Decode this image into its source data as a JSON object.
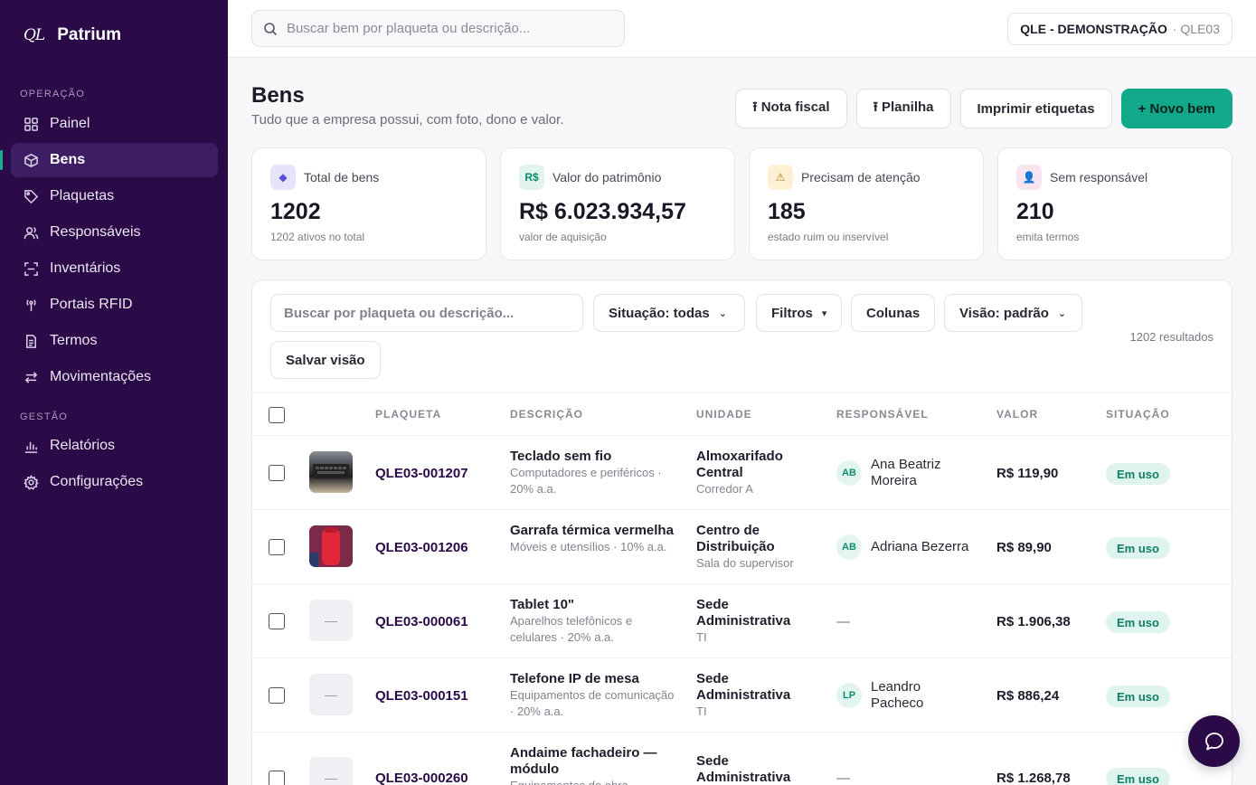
{
  "brand": {
    "logo": "QL",
    "name": "Patrium"
  },
  "sidebar": {
    "section_operacao": "OPERAÇÃO",
    "section_gestao": "GESTÃO",
    "items": [
      {
        "label": "Painel",
        "icon": "grid-icon"
      },
      {
        "label": "Bens",
        "icon": "box-icon"
      },
      {
        "label": "Plaquetas",
        "icon": "tag-icon"
      },
      {
        "label": "Responsáveis",
        "icon": "users-icon"
      },
      {
        "label": "Inventários",
        "icon": "scan-icon"
      },
      {
        "label": "Portais RFID",
        "icon": "antenna-icon"
      },
      {
        "label": "Termos",
        "icon": "document-icon"
      },
      {
        "label": "Movimentações",
        "icon": "arrows-icon"
      },
      {
        "label": "Relatórios",
        "icon": "bar-chart-icon"
      },
      {
        "label": "Configurações",
        "icon": "gear-icon"
      }
    ]
  },
  "topbar": {
    "search_placeholder": "Buscar bem por plaqueta ou descrição...",
    "tenant_name": "QLE - DEMONSTRAÇÃO",
    "tenant_code": "· QLE03"
  },
  "header": {
    "title": "Bens",
    "subtitle": "Tudo que a empresa possui, com foto, dono e valor.",
    "actions": {
      "nota_fiscal": "⭱ Nota fiscal",
      "planilha": "⭱ Planilha",
      "imprimir": "Imprimir etiquetas",
      "novo": "+ Novo bem"
    }
  },
  "stats": [
    {
      "icon_text": "◆",
      "label": "Total de bens",
      "value": "1202",
      "caption": "1202 ativos no total",
      "color": "#e6e4fb"
    },
    {
      "icon_text": "R$",
      "label": "Valor do patrimônio",
      "value": "R$ 6.023.934,57",
      "caption": "valor de aquisição",
      "color": "#e1f4ee"
    },
    {
      "icon_text": "⚠",
      "label": "Precisam de atenção",
      "value": "185",
      "caption": "estado ruim ou inservível",
      "color": "#fdf0d4"
    },
    {
      "icon_text": "👤",
      "label": "Sem responsável",
      "value": "210",
      "caption": "emita termos",
      "color": "#f8e3f0"
    }
  ],
  "filters": {
    "search_placeholder": "Buscar por plaqueta ou descrição...",
    "situacao": "Situação: todas",
    "filtros": "Filtros",
    "colunas": "Colunas",
    "visao": "Visão: padrão",
    "salvar": "Salvar visão",
    "results": "1202 resultados"
  },
  "table": {
    "headers": {
      "plaqueta": "PLAQUETA",
      "descricao": "DESCRIÇÃO",
      "unidade": "UNIDADE",
      "responsavel": "RESPONSÁVEL",
      "valor": "VALOR",
      "situacao": "SITUAÇÃO"
    },
    "rows": [
      {
        "tag": "QLE03-001207",
        "title": "Teclado sem fio",
        "sub": "Computadores e periféricos · 20% a.a.",
        "unit": "Almoxarifado Central",
        "unit_sub": "Corredor A",
        "initials": "AB",
        "resp": "Ana Beatriz Moreira",
        "value": "R$ 119,90",
        "status": "Em uso",
        "thumb": "—"
      },
      {
        "tag": "QLE03-001206",
        "title": "Garrafa térmica vermelha",
        "sub": "Móveis e utensílios · 10% a.a.",
        "unit": "Centro de Distribuição",
        "unit_sub": "Sala do supervisor",
        "initials": "AB",
        "resp": "Adriana Bezerra",
        "value": "R$ 89,90",
        "status": "Em uso",
        "thumb": "—"
      },
      {
        "tag": "QLE03-000061",
        "title": "Tablet 10\"",
        "sub": "Aparelhos telefônicos e celulares · 20% a.a.",
        "unit": "Sede Administrativa",
        "unit_sub": "TI",
        "initials": "",
        "resp": "—",
        "value": "R$ 1.906,38",
        "status": "Em uso",
        "thumb": "—"
      },
      {
        "tag": "QLE03-000151",
        "title": "Telefone IP de mesa",
        "sub": "Equipamentos de comunicação · 20% a.a.",
        "unit": "Sede Administrativa",
        "unit_sub": "TI",
        "initials": "LP",
        "resp": "Leandro Pacheco",
        "value": "R$ 886,24",
        "status": "Em uso",
        "thumb": "—"
      },
      {
        "tag": "QLE03-000260",
        "title": "Andaime fachadeiro — módulo",
        "sub": "Equipamentos de obra",
        "unit": "Sede Administrativa",
        "unit_sub": "",
        "initials": "",
        "resp": "—",
        "value": "R$ 1.268,78",
        "status": "Em uso",
        "thumb": "—"
      }
    ]
  }
}
